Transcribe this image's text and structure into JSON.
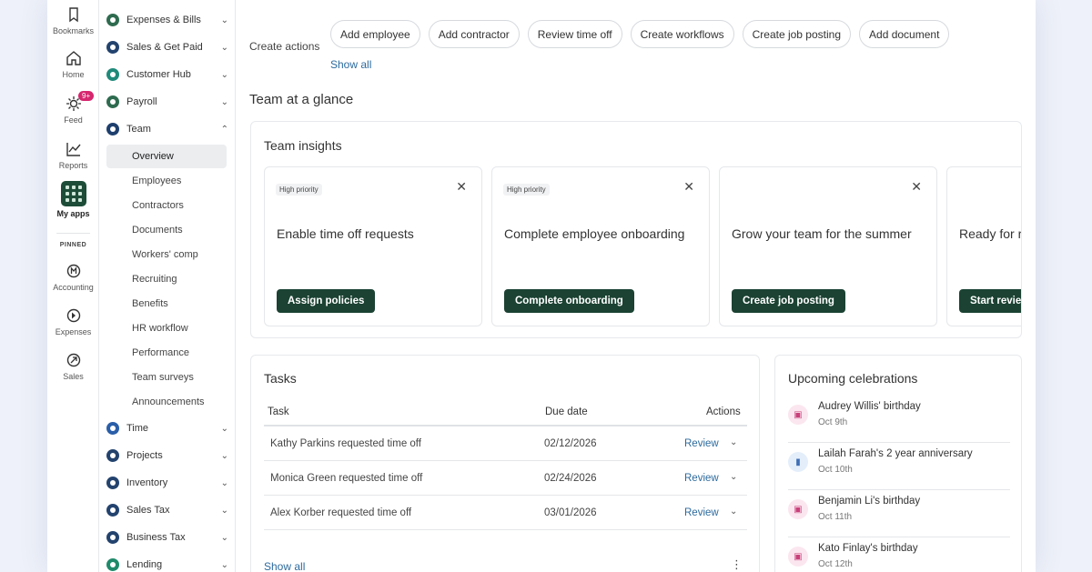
{
  "rail": {
    "bookmarks": "Bookmarks",
    "home": "Home",
    "feed": "Feed",
    "feed_badge": "9+",
    "reports": "Reports",
    "my_apps": "My apps",
    "pinned": "PINNED",
    "accounting": "Accounting",
    "expenses": "Expenses",
    "sales": "Sales",
    "accent": "#1d4d38",
    "badge_color": "#d6266e"
  },
  "nav": {
    "items": [
      {
        "label": "Expenses & Bills",
        "color": "#2e6b4f"
      },
      {
        "label": "Sales & Get Paid",
        "color": "#23436e"
      },
      {
        "label": "Customer Hub",
        "color": "#1f8a7a"
      },
      {
        "label": "Payroll",
        "color": "#2e6b4f"
      },
      {
        "label": "Team",
        "color": "#1d3f6e"
      }
    ],
    "team_sub": [
      "Overview",
      "Employees",
      "Contractors",
      "Documents",
      "Workers' comp",
      "Recruiting",
      "Benefits",
      "HR workflow",
      "Performance",
      "Team surveys",
      "Announcements"
    ],
    "items_bottom": [
      {
        "label": "Time",
        "color": "#2a5ea8"
      },
      {
        "label": "Projects",
        "color": "#23436e"
      },
      {
        "label": "Inventory",
        "color": "#23436e"
      },
      {
        "label": "Sales Tax",
        "color": "#23436e"
      },
      {
        "label": "Business Tax",
        "color": "#23436e"
      },
      {
        "label": "Lending",
        "color": "#1f8a6a"
      }
    ]
  },
  "create": {
    "label": "Create actions",
    "chips": [
      "Add employee",
      "Add contractor",
      "Review time off",
      "Create workflows",
      "Create job posting",
      "Add document"
    ],
    "show_all": "Show all"
  },
  "team_glance": {
    "title": "Team at a glance",
    "insights_title": "Team insights",
    "cards": [
      {
        "priority": "High priority",
        "title": "Enable time off requests",
        "button": "Assign policies"
      },
      {
        "priority": "High priority",
        "title": "Complete employee onboarding",
        "button": "Complete onboarding"
      },
      {
        "priority": "",
        "title": "Grow your team for the summer",
        "button": "Create job posting"
      },
      {
        "priority": "",
        "title": "Ready for review?",
        "button": "Start review"
      }
    ]
  },
  "tasks": {
    "title": "Tasks",
    "columns": [
      "Task",
      "Due date",
      "Actions"
    ],
    "rows": [
      {
        "task": "Kathy Parkins requested time off",
        "due": "02/12/2026",
        "action": "Review"
      },
      {
        "task": "Monica Green requested time off",
        "due": "02/24/2026",
        "action": "Review"
      },
      {
        "task": "Alex Korber requested time off",
        "due": "03/01/2026",
        "action": "Review"
      }
    ],
    "show_all": "Show all"
  },
  "celebrations": {
    "title": "Upcoming celebrations",
    "items": [
      {
        "name": "Audrey Willis' birthday",
        "date": "Oct 9th",
        "type": "birthday"
      },
      {
        "name": "Lailah Farah's 2 year anniversary",
        "date": "Oct 10th",
        "type": "anniversary"
      },
      {
        "name": "Benjamin Li's birthday",
        "date": "Oct 11th",
        "type": "birthday"
      },
      {
        "name": "Kato Finlay's birthday",
        "date": "Oct 12th",
        "type": "birthday"
      }
    ]
  }
}
